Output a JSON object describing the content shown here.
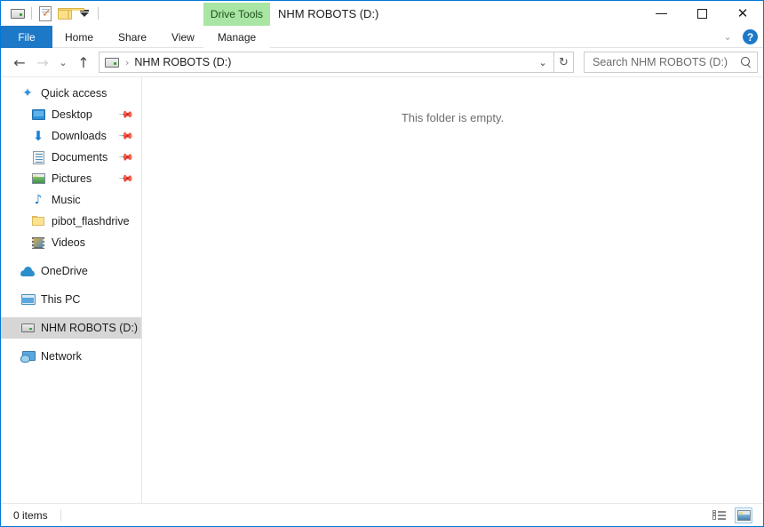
{
  "window": {
    "title": "NHM ROBOTS (D:)",
    "accent_color": "#0078d7",
    "titlebar_color": "#ffffff"
  },
  "quick_access_toolbar": {
    "items": [
      {
        "name": "drive-icon",
        "label": ""
      },
      {
        "name": "properties-icon",
        "label": ""
      },
      {
        "name": "new-folder-icon",
        "label": ""
      },
      {
        "name": "customize-dropdown-icon",
        "label": ""
      }
    ]
  },
  "window_controls": {
    "minimize": "—",
    "maximize": "□",
    "close": "✕",
    "collapse_ribbon": "⌄",
    "help": "?"
  },
  "ribbon": {
    "contextual_header": "Drive Tools",
    "contextual_header_color": "#a9e6a3",
    "contextual_header_text_color": "#1d4d1a",
    "file_tab": "File",
    "file_tab_color": "#1d78c8",
    "tabs": [
      {
        "label": "Home"
      },
      {
        "label": "Share"
      },
      {
        "label": "View"
      }
    ],
    "contextual_tab": "Manage"
  },
  "navigation": {
    "back": "←",
    "forward": "→",
    "recent_locations": "⌄",
    "up": "↑",
    "breadcrumb_separator": "›",
    "breadcrumb": "NHM ROBOTS (D:)",
    "dropdown": "⌄",
    "refresh": "↻"
  },
  "search": {
    "placeholder": "Search NHM ROBOTS (D:)",
    "value": "",
    "icon": "search-icon"
  },
  "sidebar": {
    "items": [
      {
        "label": "Quick access",
        "icon": "star-icon",
        "indent": 0,
        "pinned": false,
        "selected": false
      },
      {
        "label": "Desktop",
        "icon": "desktop-icon",
        "indent": 1,
        "pinned": true,
        "selected": false
      },
      {
        "label": "Downloads",
        "icon": "downloads-icon",
        "indent": 1,
        "pinned": true,
        "selected": false
      },
      {
        "label": "Documents",
        "icon": "documents-icon",
        "indent": 1,
        "pinned": true,
        "selected": false
      },
      {
        "label": "Pictures",
        "icon": "pictures-icon",
        "indent": 1,
        "pinned": true,
        "selected": false
      },
      {
        "label": "Music",
        "icon": "music-icon",
        "indent": 1,
        "pinned": false,
        "selected": false
      },
      {
        "label": "pibot_flashdrive",
        "icon": "folder-icon",
        "indent": 1,
        "pinned": false,
        "selected": false
      },
      {
        "label": "Videos",
        "icon": "videos-icon",
        "indent": 1,
        "pinned": false,
        "selected": false
      },
      {
        "label": "OneDrive",
        "icon": "cloud-icon",
        "indent": 0,
        "pinned": false,
        "selected": false
      },
      {
        "label": "This PC",
        "icon": "computer-icon",
        "indent": 0,
        "pinned": false,
        "selected": false
      },
      {
        "label": "NHM ROBOTS (D:)",
        "icon": "drive-icon",
        "indent": 0,
        "pinned": false,
        "selected": true
      },
      {
        "label": "Network",
        "icon": "network-icon",
        "indent": 0,
        "pinned": false,
        "selected": false
      }
    ],
    "selected_color": "#d6d6d6"
  },
  "content": {
    "empty_message": "This folder is empty."
  },
  "statusbar": {
    "item_count": "0 items",
    "view_details": "details-view",
    "view_large_icons": "large-icons-view"
  }
}
